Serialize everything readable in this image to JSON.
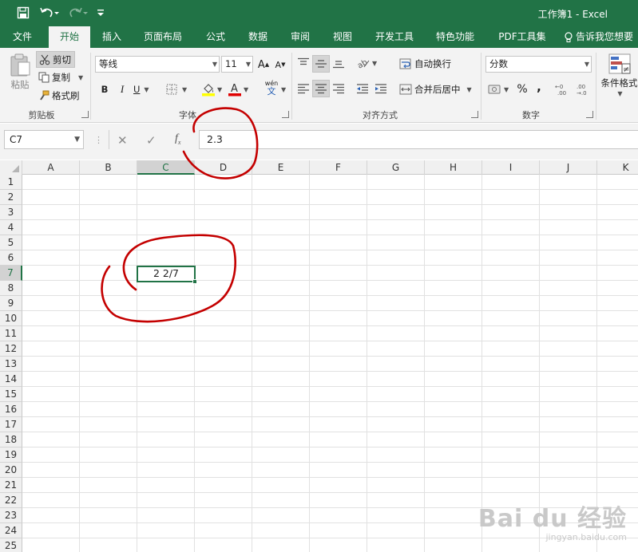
{
  "titlebar": {
    "title": "工作簿1 - Excel"
  },
  "ribbon_tabs": [
    {
      "label": "文件"
    },
    {
      "label": "开始"
    },
    {
      "label": "插入"
    },
    {
      "label": "页面布局"
    },
    {
      "label": "公式"
    },
    {
      "label": "数据"
    },
    {
      "label": "审阅"
    },
    {
      "label": "视图"
    },
    {
      "label": "开发工具"
    },
    {
      "label": "特色功能"
    },
    {
      "label": "PDF工具集"
    },
    {
      "label": "告诉我您想要"
    }
  ],
  "clipboard": {
    "paste": "粘贴",
    "cut": "剪切",
    "copy": "复制",
    "format_painter": "格式刷",
    "group": "剪贴板"
  },
  "font": {
    "name": "等线",
    "size": "11",
    "bold": "B",
    "italic": "I",
    "underline": "U",
    "wen": "wén",
    "wen_char": "文",
    "group": "字体"
  },
  "alignment": {
    "wrap_text": "自动换行",
    "merge_center": "合并后居中",
    "group": "对齐方式"
  },
  "number": {
    "format": "分数",
    "percent": "%",
    "comma": ",",
    "group": "数字"
  },
  "styles": {
    "conditional": "条件格式"
  },
  "formula_bar": {
    "name_box": "C7",
    "formula_value": "2.3"
  },
  "grid": {
    "columns": [
      "A",
      "B",
      "C",
      "D",
      "E",
      "F",
      "G",
      "H",
      "I",
      "J",
      "K"
    ],
    "rows": [
      "1",
      "2",
      "3",
      "4",
      "5",
      "6",
      "7",
      "8",
      "9",
      "10",
      "11",
      "12",
      "13",
      "14",
      "15",
      "16",
      "17",
      "18",
      "19",
      "20",
      "21",
      "22",
      "23",
      "24",
      "25"
    ],
    "active_cell_value": "2 2/7"
  },
  "watermark": {
    "logo": "Bai du 经验",
    "url": "jingyan.baidu.com"
  },
  "colors": {
    "accent": "#217346",
    "annotation": "#c40000"
  }
}
